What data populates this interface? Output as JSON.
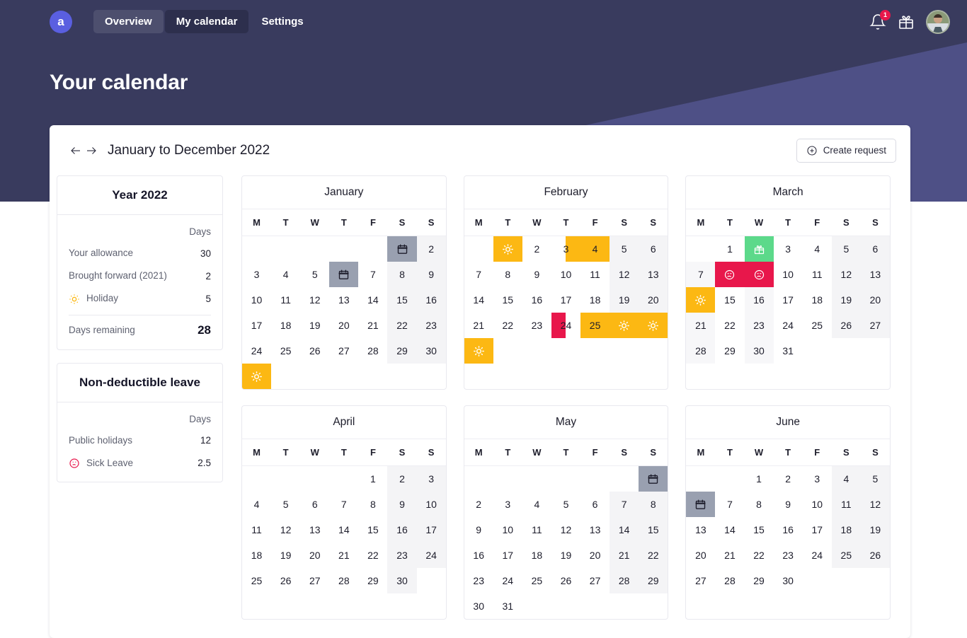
{
  "brand": {
    "logo_letter": "a",
    "accent": "#5a5fe0",
    "header_bg": "#393b5e",
    "header_band": "#4e5086"
  },
  "topbar": {
    "tabs": [
      {
        "label": "Overview",
        "state": "hover"
      },
      {
        "label": "My calendar",
        "state": "active"
      },
      {
        "label": "Settings",
        "state": "default"
      }
    ],
    "notifications_icon": "bell-icon",
    "notifications_count": "1",
    "gift_icon": "gift-icon",
    "avatar_name": "user-avatar"
  },
  "page": {
    "title": "Your calendar"
  },
  "toolbar": {
    "prev_label": "←",
    "next_label": "→",
    "range_title": "January to December 2022",
    "create_label": "Create request",
    "create_icon": "plus-circle-icon"
  },
  "sidebar": {
    "allowance_panel": {
      "title": "Year 2022",
      "days_header": "Days",
      "rows": [
        {
          "label": "Your allowance",
          "value": "30",
          "icon": null
        },
        {
          "label": "Brought forward (2021)",
          "value": "2",
          "icon": null
        },
        {
          "label": "Holiday",
          "value": "5",
          "icon": "sun-icon",
          "icon_color": "#fcb813"
        }
      ],
      "total": {
        "label": "Days remaining",
        "value": "28"
      }
    },
    "nondeductible_panel": {
      "title": "Non-deductible leave",
      "days_header": "Days",
      "rows": [
        {
          "label": "Public holidays",
          "value": "12",
          "icon": null
        },
        {
          "label": "Sick Leave",
          "value": "2.5",
          "icon": "sad-face-icon",
          "icon_color": "#e8174b"
        }
      ]
    }
  },
  "calendar": {
    "dow": [
      "M",
      "T",
      "W",
      "T",
      "F",
      "S",
      "S"
    ],
    "legend_colors": {
      "holiday": "#fcb813",
      "sick": "#e8174b",
      "birthday": "#5cd98a",
      "public_holiday": "#99a0b0",
      "weekend": "#f4f4f6"
    },
    "months": [
      {
        "name": "January",
        "lead_blank": 5,
        "days": 31,
        "events": [
          {
            "day": 1,
            "type": "public_holiday",
            "icon": "calendar-icon",
            "span": 1,
            "hide_number": true
          },
          {
            "day": 6,
            "type": "public_holiday",
            "icon": "calendar-icon",
            "span": 1,
            "hide_number": true
          },
          {
            "day": 31,
            "type": "holiday",
            "icon": "sun-icon",
            "span": 1,
            "hide_number": true
          }
        ]
      },
      {
        "name": "February",
        "lead_blank": 1,
        "days": 28,
        "events": [
          {
            "day": 1,
            "type": "holiday",
            "icon": "sun-icon",
            "span": 1,
            "hide_number": true
          },
          {
            "day": 3,
            "type": "holiday",
            "half": "right",
            "span": 1,
            "hide_number": false
          },
          {
            "day": 4,
            "type": "holiday",
            "span": 1,
            "hide_number": false
          },
          {
            "day": 24,
            "type": "sick",
            "half": "left",
            "span": 1,
            "hide_number": false
          },
          {
            "day": 25,
            "type": "holiday",
            "span": 3,
            "hide_number": false,
            "icons_on": [
              26,
              27
            ]
          },
          {
            "day": 28,
            "type": "holiday",
            "icon": "sun-icon",
            "span": 1,
            "hide_number": true
          }
        ]
      },
      {
        "name": "March",
        "lead_blank": 1,
        "days": 31,
        "col_tint": [
          0,
          2
        ],
        "col_tint_rows": [
          1,
          2,
          3,
          4
        ],
        "events": [
          {
            "day": 2,
            "type": "birthday",
            "icon": "gift-icon",
            "span": 1,
            "hide_number": true
          },
          {
            "day": 8,
            "type": "sick",
            "icon": "sad-face-icon",
            "span": 1,
            "hide_number": true
          },
          {
            "day": 9,
            "type": "sick",
            "icon": "sad-face-icon",
            "span": 1,
            "hide_number": true
          },
          {
            "day": 14,
            "type": "holiday",
            "icon": "sun-icon",
            "span": 1,
            "hide_number": true
          }
        ]
      },
      {
        "name": "April",
        "lead_blank": 4,
        "days": 30,
        "events": []
      },
      {
        "name": "May",
        "lead_blank": 6,
        "days": 31,
        "events": [
          {
            "day": 1,
            "type": "public_holiday",
            "icon": "calendar-icon",
            "span": 1,
            "hide_number": true
          }
        ]
      },
      {
        "name": "June",
        "lead_blank": 2,
        "days": 30,
        "events": [
          {
            "day": 6,
            "type": "public_holiday",
            "icon": "calendar-icon",
            "span": 1,
            "hide_number": true
          }
        ]
      }
    ]
  }
}
